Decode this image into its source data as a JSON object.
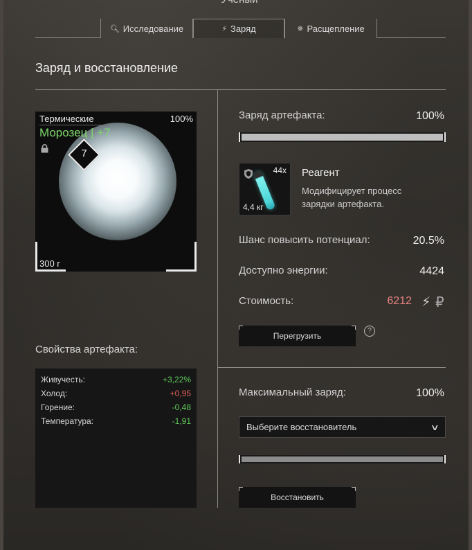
{
  "window": {
    "title": "Учёный"
  },
  "tabs": [
    {
      "label": "Исследование",
      "icon": "magnifier-icon"
    },
    {
      "label": "Заряд",
      "icon": "lightning-icon",
      "active": true
    },
    {
      "label": "Расщепление",
      "icon": "bug-icon"
    }
  ],
  "section": {
    "title": "Заряд и восстановление"
  },
  "artifact": {
    "category": "Термические",
    "percent": "100%",
    "name": "Морозец | +7",
    "weight": "300 г",
    "level": "7",
    "name_color": "#7fd86c"
  },
  "properties": {
    "title": "Свойства артефакта:",
    "rows": [
      {
        "name": "Живучесть:",
        "value": "+3,22%",
        "sign": "pos"
      },
      {
        "name": "Холод:",
        "value": "+0,95",
        "sign": "neg"
      },
      {
        "name": "Горение:",
        "value": "-0,48",
        "sign": "pos"
      },
      {
        "name": "Температура:",
        "value": "-1,91",
        "sign": "pos"
      }
    ]
  },
  "charge": {
    "label": "Заряд артефакта:",
    "value": "100%",
    "fill_fraction": 1.0
  },
  "reagent": {
    "count": "44x",
    "weight": "4,4 кг",
    "name": "Реагент",
    "description": "Модифицирует процесс зарядки артефакта."
  },
  "stats": {
    "chance_label": "Шанс повысить потенциал:",
    "chance_value": "20.5%",
    "energy_label": "Доступно энергии:",
    "energy_value": "4424",
    "cost_label": "Стоимость:",
    "cost_value": "6212",
    "cost_color": "#e7837e"
  },
  "overcharge": {
    "label": "Перегрузить",
    "help": "?"
  },
  "restore": {
    "max_label": "Максимальный заряд:",
    "max_value": "100%",
    "select_placeholder": "Выберите восстановитель",
    "fill_fraction": 1.0,
    "button_label": "Восстановить"
  }
}
